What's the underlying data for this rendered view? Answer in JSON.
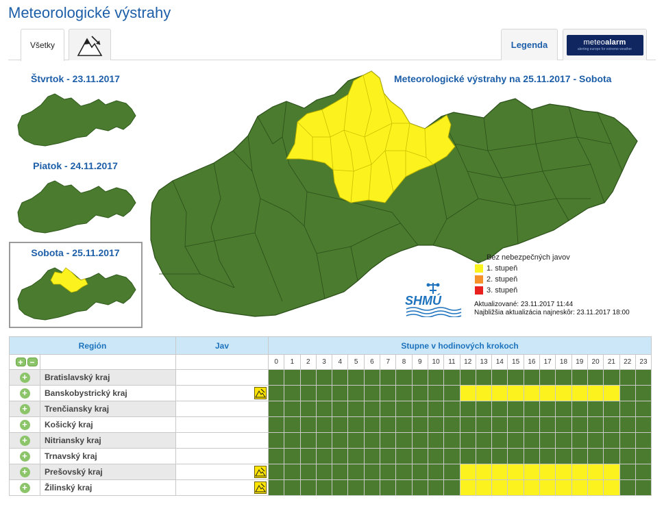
{
  "page_title": "Meteorologické výstrahy",
  "tabs": {
    "all_label": "Všetky",
    "legend_label": "Legenda",
    "meteoalarm_brand_a": "meteo",
    "meteoalarm_brand_b": "alarm",
    "meteoalarm_tagline": "alerting europe for extreme weather"
  },
  "days": [
    {
      "title": "Štvrtok - 23.11.2017"
    },
    {
      "title": "Piatok - 24.11.2017"
    },
    {
      "title": "Sobota - 25.11.2017"
    }
  ],
  "main_map": {
    "title": "Meteorologické výstrahy na 25.11.2017 - Sobota"
  },
  "legend": [
    {
      "label": "Bez nebezpečných javov",
      "color": "#4a7b2e"
    },
    {
      "label": "1. stupeň",
      "color": "#fcf31e"
    },
    {
      "label": "2. stupeň",
      "color": "#f7922a"
    },
    {
      "label": "3. stupeň",
      "color": "#e8201e"
    }
  ],
  "logo_text": "SHMÚ",
  "updated": "Aktualizované: 23.11.2017 11:44",
  "next_update": "Najbližšia aktualizácia najneskôr: 23.11.2017 18:00",
  "table": {
    "header_region": "Región",
    "header_jav": "Jav",
    "header_hours": "Stupne v hodinových krokoch",
    "expand_all": "+",
    "collapse_all": "−",
    "hours": [
      "0",
      "1",
      "2",
      "3",
      "4",
      "5",
      "6",
      "7",
      "8",
      "9",
      "10",
      "11",
      "12",
      "13",
      "14",
      "15",
      "16",
      "17",
      "18",
      "19",
      "20",
      "21",
      "22",
      "23"
    ],
    "regions": [
      {
        "name": "Bratislavský kraj",
        "warning": false,
        "levels": [
          0,
          0,
          0,
          0,
          0,
          0,
          0,
          0,
          0,
          0,
          0,
          0,
          0,
          0,
          0,
          0,
          0,
          0,
          0,
          0,
          0,
          0,
          0,
          0
        ]
      },
      {
        "name": "Banskobystrický kraj",
        "warning": true,
        "levels": [
          0,
          0,
          0,
          0,
          0,
          0,
          0,
          0,
          0,
          0,
          0,
          0,
          1,
          1,
          1,
          1,
          1,
          1,
          1,
          1,
          1,
          1,
          0,
          0
        ]
      },
      {
        "name": "Trenčiansky kraj",
        "warning": false,
        "levels": [
          0,
          0,
          0,
          0,
          0,
          0,
          0,
          0,
          0,
          0,
          0,
          0,
          0,
          0,
          0,
          0,
          0,
          0,
          0,
          0,
          0,
          0,
          0,
          0
        ]
      },
      {
        "name": "Košický kraj",
        "warning": false,
        "levels": [
          0,
          0,
          0,
          0,
          0,
          0,
          0,
          0,
          0,
          0,
          0,
          0,
          0,
          0,
          0,
          0,
          0,
          0,
          0,
          0,
          0,
          0,
          0,
          0
        ]
      },
      {
        "name": "Nitriansky kraj",
        "warning": false,
        "levels": [
          0,
          0,
          0,
          0,
          0,
          0,
          0,
          0,
          0,
          0,
          0,
          0,
          0,
          0,
          0,
          0,
          0,
          0,
          0,
          0,
          0,
          0,
          0,
          0
        ]
      },
      {
        "name": "Trnavský kraj",
        "warning": false,
        "levels": [
          0,
          0,
          0,
          0,
          0,
          0,
          0,
          0,
          0,
          0,
          0,
          0,
          0,
          0,
          0,
          0,
          0,
          0,
          0,
          0,
          0,
          0,
          0,
          0
        ]
      },
      {
        "name": "Prešovský kraj",
        "warning": true,
        "levels": [
          0,
          0,
          0,
          0,
          0,
          0,
          0,
          0,
          0,
          0,
          0,
          0,
          1,
          1,
          1,
          1,
          1,
          1,
          1,
          1,
          1,
          1,
          0,
          0
        ]
      },
      {
        "name": "Žilinský kraj",
        "warning": true,
        "levels": [
          0,
          0,
          0,
          0,
          0,
          0,
          0,
          0,
          0,
          0,
          0,
          0,
          1,
          1,
          1,
          1,
          1,
          1,
          1,
          1,
          1,
          1,
          0,
          0
        ]
      }
    ]
  }
}
